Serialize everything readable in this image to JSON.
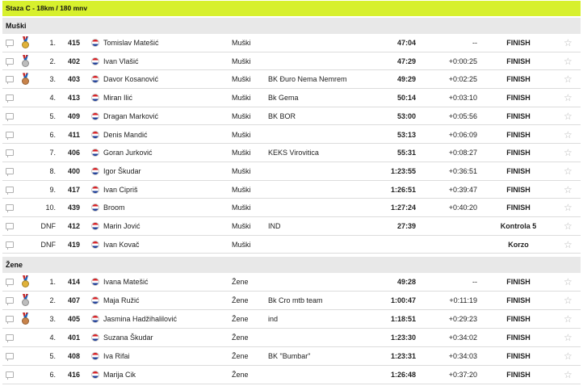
{
  "stage_title": "Staza C - 18km / 180 mnv",
  "colors": {
    "header_bar": "#d7f02d",
    "group_bar": "#e8e8e8",
    "gold": "#e0b23a",
    "silver": "#bdbdbd",
    "bronze": "#c8834a"
  },
  "icons": {
    "comment": "comment-icon",
    "flag": "croatia-flag-icon",
    "star": "star-icon",
    "medal": "medal-icon"
  },
  "groups": [
    {
      "label": "Muški",
      "rows": [
        {
          "medal": "gold",
          "place": "1.",
          "bib": "415",
          "name": "Tomislav Matešić",
          "category": "Muški",
          "club": "",
          "time": "47:04",
          "gap": "--",
          "status": "FINISH"
        },
        {
          "medal": "silver",
          "place": "2.",
          "bib": "402",
          "name": "Ivan Vlašić",
          "category": "Muški",
          "club": "",
          "time": "47:29",
          "gap": "+0:00:25",
          "status": "FINISH"
        },
        {
          "medal": "bronze",
          "place": "3.",
          "bib": "403",
          "name": "Davor Kosanović",
          "category": "Muški",
          "club": "BK Đuro Nema Nemrem",
          "time": "49:29",
          "gap": "+0:02:25",
          "status": "FINISH"
        },
        {
          "medal": "",
          "place": "4.",
          "bib": "413",
          "name": "Miran Ilić",
          "category": "Muški",
          "club": "Bk Gema",
          "time": "50:14",
          "gap": "+0:03:10",
          "status": "FINISH"
        },
        {
          "medal": "",
          "place": "5.",
          "bib": "409",
          "name": "Dragan Marković",
          "category": "Muški",
          "club": "BK BOR",
          "time": "53:00",
          "gap": "+0:05:56",
          "status": "FINISH"
        },
        {
          "medal": "",
          "place": "6.",
          "bib": "411",
          "name": "Denis Mandić",
          "category": "Muški",
          "club": "",
          "time": "53:13",
          "gap": "+0:06:09",
          "status": "FINISH"
        },
        {
          "medal": "",
          "place": "7.",
          "bib": "406",
          "name": "Goran Jurković",
          "category": "Muški",
          "club": "KEKS Virovitica",
          "time": "55:31",
          "gap": "+0:08:27",
          "status": "FINISH"
        },
        {
          "medal": "",
          "place": "8.",
          "bib": "400",
          "name": "Igor Škudar",
          "category": "Muški",
          "club": "",
          "time": "1:23:55",
          "gap": "+0:36:51",
          "status": "FINISH"
        },
        {
          "medal": "",
          "place": "9.",
          "bib": "417",
          "name": "Ivan Cipriš",
          "category": "Muški",
          "club": "",
          "time": "1:26:51",
          "gap": "+0:39:47",
          "status": "FINISH"
        },
        {
          "medal": "",
          "place": "10.",
          "bib": "439",
          "name": "Broom",
          "category": "Muški",
          "club": "",
          "time": "1:27:24",
          "gap": "+0:40:20",
          "status": "FINISH"
        },
        {
          "medal": "",
          "place": "DNF",
          "bib": "412",
          "name": "Marin Jović",
          "category": "Muški",
          "club": "IND",
          "time": "27:39",
          "gap": "",
          "status": "Kontrola 5"
        },
        {
          "medal": "",
          "place": "DNF",
          "bib": "419",
          "name": "Ivan Kovač",
          "category": "Muški",
          "club": "",
          "time": "",
          "gap": "",
          "status": "Korzo"
        }
      ]
    },
    {
      "label": "Žene",
      "rows": [
        {
          "medal": "gold",
          "place": "1.",
          "bib": "414",
          "name": "Ivana Matešić",
          "category": "Žene",
          "club": "",
          "time": "49:28",
          "gap": "--",
          "status": "FINISH"
        },
        {
          "medal": "silver",
          "place": "2.",
          "bib": "407",
          "name": "Maja Ružić",
          "category": "Žene",
          "club": "Bk Cro mtb team",
          "time": "1:00:47",
          "gap": "+0:11:19",
          "status": "FINISH"
        },
        {
          "medal": "bronze",
          "place": "3.",
          "bib": "405",
          "name": "Jasmina Hadžihalilović",
          "category": "Žene",
          "club": "ind",
          "time": "1:18:51",
          "gap": "+0:29:23",
          "status": "FINISH"
        },
        {
          "medal": "",
          "place": "4.",
          "bib": "401",
          "name": "Suzana Škudar",
          "category": "Žene",
          "club": "",
          "time": "1:23:30",
          "gap": "+0:34:02",
          "status": "FINISH"
        },
        {
          "medal": "",
          "place": "5.",
          "bib": "408",
          "name": "Iva Rifai",
          "category": "Žene",
          "club": "BK \"Bumbar\"",
          "time": "1:23:31",
          "gap": "+0:34:03",
          "status": "FINISH"
        },
        {
          "medal": "",
          "place": "6.",
          "bib": "416",
          "name": "Marija Cik",
          "category": "Žene",
          "club": "",
          "time": "1:26:48",
          "gap": "+0:37:20",
          "status": "FINISH"
        }
      ]
    }
  ]
}
